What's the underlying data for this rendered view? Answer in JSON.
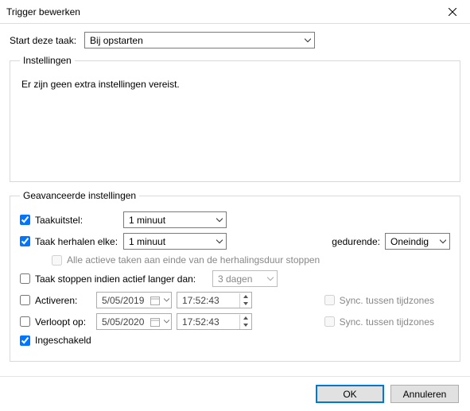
{
  "title": "Trigger bewerken",
  "start_label": "Start deze taak:",
  "start_value": "Bij opstarten",
  "settings_group": "Instellingen",
  "settings_text": "Er zijn geen extra instellingen vereist.",
  "advanced_group": "Geavanceerde instellingen",
  "delay": {
    "label": "Taakuitstel:",
    "value": "1 minuut"
  },
  "repeat": {
    "label": "Taak herhalen elke:",
    "value": "1 minuut",
    "during_label": "gedurende:",
    "during_value": "Oneindig"
  },
  "stopall": "Alle actieve taken aan einde van de herhalingsduur stoppen",
  "stoprun": {
    "label": "Taak stoppen indien actief langer dan:",
    "value": "3 dagen"
  },
  "activate": {
    "label": "Activeren:",
    "date": "5/05/2019",
    "time": "17:52:43",
    "sync": "Sync. tussen tijdzones"
  },
  "expire": {
    "label": "Verloopt op:",
    "date": "5/05/2020",
    "time": "17:52:43",
    "sync": "Sync. tussen tijdzones"
  },
  "enabled": "Ingeschakeld",
  "ok": "OK",
  "cancel": "Annuleren"
}
